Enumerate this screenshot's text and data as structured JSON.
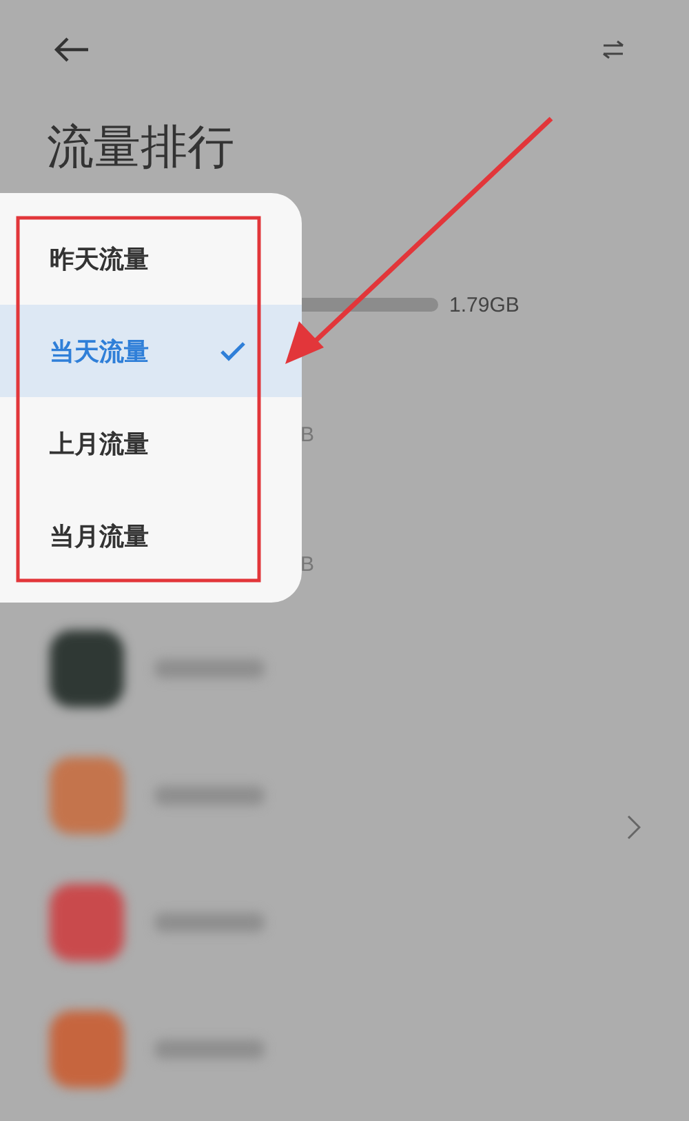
{
  "header": {
    "title": "流量排行"
  },
  "background_rows": [
    {
      "kind": "bar",
      "usage": "1.79GB"
    },
    {
      "kind": "text",
      "usage": "B"
    },
    {
      "kind": "text",
      "usage": "B"
    }
  ],
  "blurred_apps": [
    {
      "color": "#2f3834"
    },
    {
      "color": "#c4744c"
    },
    {
      "color": "#c94a4c"
    },
    {
      "color": "#c6653e"
    }
  ],
  "menu": {
    "items": [
      {
        "label": "昨天流量",
        "selected": false
      },
      {
        "label": "当天流量",
        "selected": true
      },
      {
        "label": "上月流量",
        "selected": false
      },
      {
        "label": "当月流量",
        "selected": false
      }
    ]
  }
}
